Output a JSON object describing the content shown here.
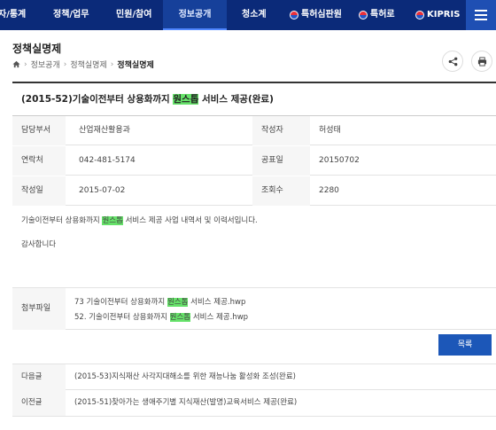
{
  "nav": {
    "items": [
      {
        "label": "자/통계"
      },
      {
        "label": "정책/업무"
      },
      {
        "label": "민원/참여"
      },
      {
        "label": "정보공개"
      },
      {
        "label": "청소계"
      }
    ],
    "external": [
      {
        "label": "특허심판원"
      },
      {
        "label": "특허로"
      },
      {
        "label": "KIPRIS"
      }
    ],
    "active_index": 3
  },
  "page": {
    "title": "정책실명제",
    "breadcrumb": [
      "정보공개",
      "정책실명제",
      "정책실명제"
    ]
  },
  "article": {
    "title_pre": "(2015-52)기술이전부터 상용화까지 ",
    "title_hl": "원스톱",
    "title_post": " 서비스 제공(완료)",
    "info": {
      "dept_label": "담당부서",
      "dept_value": "산업재산활용과",
      "author_label": "작성자",
      "author_value": "허성태",
      "contact_label": "연락처",
      "contact_value": "042-481-5174",
      "pubdate_label": "공표일",
      "pubdate_value": "20150702",
      "created_label": "작성일",
      "created_value": "2015-07-02",
      "views_label": "조회수",
      "views_value": "2280"
    },
    "body_pre": "기술이전부터 상용화까지 ",
    "body_hl": "원스톱",
    "body_post": " 서비스 제공 사업 내역서 및 이력서입니다.",
    "closing": "감사합니다",
    "attach_label": "첨부파일",
    "files": [
      {
        "pre": "73 기술이전부터 상용화까지 ",
        "hl": "원스톱",
        "post": " 서비스 제공.hwp"
      },
      {
        "pre": "52. 기술이전부터 상용화까지 ",
        "hl": "원스톱",
        "post": " 서비스 제공.hwp"
      }
    ],
    "list_button": "목록",
    "next_label": "다음글",
    "next_value": "(2015-53)지식재산 사각지대해소를 위한 재능나눔 활성화 조성(완료)",
    "prev_label": "이전글",
    "prev_value": "(2015-51)찾아가는 생애주기별 지식재산(발명)교육서비스 제공(완료)"
  },
  "colors": {
    "nav_bg": "#0b2a79",
    "highlight": "#66e26a",
    "button": "#1c57b8"
  }
}
